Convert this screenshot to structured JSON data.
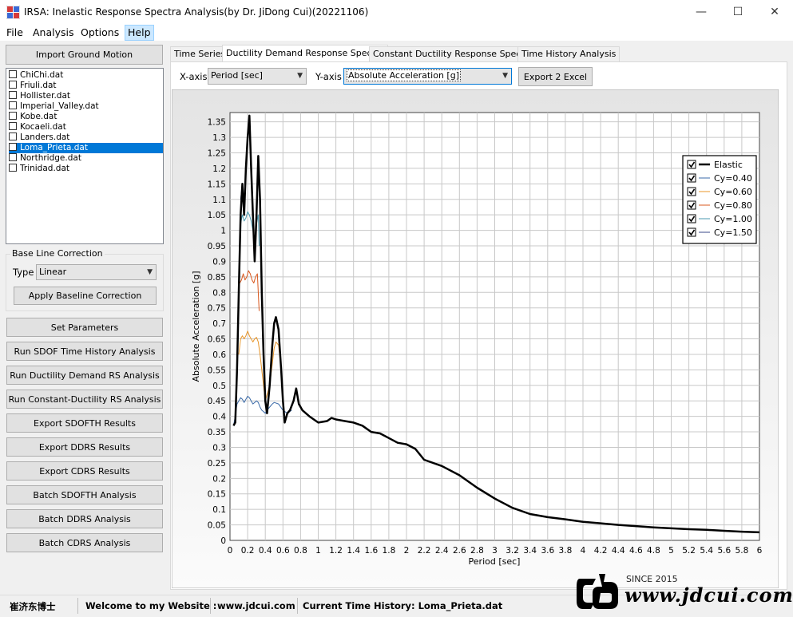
{
  "window": {
    "title": "IRSA: Inelastic Response Spectra Analysis(by Dr. JiDong Cui)(20221106)",
    "minimize": "—",
    "maximize": "☐",
    "close": "✕"
  },
  "menu": [
    "File",
    "Analysis",
    "Options",
    "Help"
  ],
  "left": {
    "import_button": "Import Ground Motion",
    "files": [
      "ChiChi.dat",
      "Friuli.dat",
      "Hollister.dat",
      "Imperial_Valley.dat",
      "Kobe.dat",
      "Kocaeli.dat",
      "Landers.dat",
      "Loma_Prieta.dat",
      "Northridge.dat",
      "Trinidad.dat"
    ],
    "selected_index": 7,
    "baseline": {
      "group_title": "Base Line Correction",
      "type_label": "Type",
      "type_value": "Linear",
      "apply_button": "Apply Baseline Correction"
    },
    "buttons": [
      "Set Parameters",
      "Run SDOF Time History Analysis",
      "Run Ductility Demand RS Analysis",
      "Run Constant-Ductility RS Analysis",
      "Export SDOFTH Results",
      "Export DDRS Results",
      "Export CDRS Results",
      "Batch SDOFTH Analysis",
      "Batch DDRS Analysis",
      "Batch CDRS Analysis"
    ]
  },
  "tabs": [
    "Time Series",
    "Ductility Demand Response Spectra",
    "Constant Ductility Response Spectra",
    "Time History Analysis"
  ],
  "active_tab": 1,
  "toolbar": {
    "xaxis_label": "X-axis",
    "xaxis_value": "Period [sec]",
    "yaxis_label": "Y-axis",
    "yaxis_value": "Absolute Acceleration [g]",
    "export_button": "Export 2 Excel"
  },
  "status": {
    "author": "崔济东博士",
    "welcome": "Welcome to my Website :",
    "website": "www.jdcui.com",
    "current": "Current Time History: Loma_Prieta.dat"
  },
  "brand": {
    "since": "SINCE 2015",
    "url": "www.jdcui.com"
  },
  "chart_data": {
    "type": "line",
    "xlabel": "Period [sec]",
    "ylabel": "Absolute Acceleration [g]",
    "xlim": [
      0,
      6
    ],
    "ylim": [
      0,
      1.38
    ],
    "xticks": [
      "0",
      "0.2",
      "0.4",
      "0.6",
      "0.8",
      "1",
      "1.2",
      "1.4",
      "1.6",
      "1.8",
      "2",
      "2.2",
      "2.4",
      "2.6",
      "2.8",
      "3",
      "3.2",
      "3.4",
      "3.6",
      "3.8",
      "4",
      "4.2",
      "4.4",
      "4.6",
      "4.8",
      "5",
      "5.2",
      "5.4",
      "5.6",
      "5.8",
      "6"
    ],
    "yticks": [
      "0",
      "0.05",
      "0.1",
      "0.15",
      "0.2",
      "0.25",
      "0.3",
      "0.35",
      "0.4",
      "0.45",
      "0.5",
      "0.55",
      "0.6",
      "0.65",
      "0.7",
      "0.75",
      "0.8",
      "0.85",
      "0.9",
      "0.95",
      "1",
      "1.05",
      "1.1",
      "1.15",
      "1.2",
      "1.25",
      "1.3",
      "1.35"
    ],
    "grid": true,
    "legend_position": "top-right",
    "series": [
      {
        "name": "Elastic",
        "color": "#000000",
        "width": 2.5,
        "points": [
          [
            0.04,
            0.37
          ],
          [
            0.06,
            0.38
          ],
          [
            0.08,
            0.55
          ],
          [
            0.1,
            0.8
          ],
          [
            0.12,
            1.05
          ],
          [
            0.14,
            1.15
          ],
          [
            0.16,
            1.05
          ],
          [
            0.18,
            1.2
          ],
          [
            0.2,
            1.3
          ],
          [
            0.22,
            1.37
          ],
          [
            0.24,
            1.2
          ],
          [
            0.26,
            1.05
          ],
          [
            0.28,
            0.9
          ],
          [
            0.3,
            1.05
          ],
          [
            0.32,
            1.24
          ],
          [
            0.34,
            1.1
          ],
          [
            0.36,
            0.8
          ],
          [
            0.38,
            0.6
          ],
          [
            0.4,
            0.45
          ],
          [
            0.42,
            0.41
          ],
          [
            0.45,
            0.5
          ],
          [
            0.48,
            0.63
          ],
          [
            0.5,
            0.7
          ],
          [
            0.52,
            0.72
          ],
          [
            0.55,
            0.68
          ],
          [
            0.58,
            0.55
          ],
          [
            0.6,
            0.45
          ],
          [
            0.62,
            0.38
          ],
          [
            0.65,
            0.41
          ],
          [
            0.68,
            0.42
          ],
          [
            0.72,
            0.45
          ],
          [
            0.75,
            0.49
          ],
          [
            0.78,
            0.44
          ],
          [
            0.82,
            0.42
          ],
          [
            0.9,
            0.4
          ],
          [
            1.0,
            0.38
          ],
          [
            1.1,
            0.385
          ],
          [
            1.15,
            0.395
          ],
          [
            1.2,
            0.39
          ],
          [
            1.3,
            0.385
          ],
          [
            1.4,
            0.38
          ],
          [
            1.5,
            0.37
          ],
          [
            1.6,
            0.35
          ],
          [
            1.7,
            0.345
          ],
          [
            1.8,
            0.33
          ],
          [
            1.9,
            0.315
          ],
          [
            2.0,
            0.31
          ],
          [
            2.1,
            0.295
          ],
          [
            2.2,
            0.26
          ],
          [
            2.4,
            0.24
          ],
          [
            2.6,
            0.21
          ],
          [
            2.8,
            0.17
          ],
          [
            3.0,
            0.135
          ],
          [
            3.2,
            0.105
          ],
          [
            3.4,
            0.085
          ],
          [
            3.6,
            0.075
          ],
          [
            3.8,
            0.068
          ],
          [
            4.0,
            0.06
          ],
          [
            4.2,
            0.055
          ],
          [
            4.4,
            0.05
          ],
          [
            4.6,
            0.046
          ],
          [
            4.8,
            0.042
          ],
          [
            5.0,
            0.039
          ],
          [
            5.2,
            0.036
          ],
          [
            5.4,
            0.034
          ],
          [
            5.6,
            0.031
          ],
          [
            5.8,
            0.028
          ],
          [
            6.0,
            0.026
          ]
        ]
      },
      {
        "name": "Cy=0.40",
        "color": "#3a6aa8",
        "width": 1,
        "points": [
          [
            0.04,
            0.37
          ],
          [
            0.06,
            0.4
          ],
          [
            0.08,
            0.44
          ],
          [
            0.1,
            0.45
          ],
          [
            0.12,
            0.46
          ],
          [
            0.14,
            0.455
          ],
          [
            0.16,
            0.445
          ],
          [
            0.18,
            0.455
          ],
          [
            0.2,
            0.465
          ],
          [
            0.22,
            0.46
          ],
          [
            0.24,
            0.45
          ],
          [
            0.26,
            0.44
          ],
          [
            0.28,
            0.445
          ],
          [
            0.3,
            0.45
          ],
          [
            0.32,
            0.445
          ],
          [
            0.34,
            0.43
          ],
          [
            0.36,
            0.42
          ],
          [
            0.38,
            0.415
          ],
          [
            0.4,
            0.41
          ],
          [
            0.42,
            0.42
          ],
          [
            0.45,
            0.43
          ],
          [
            0.48,
            0.44
          ],
          [
            0.5,
            0.445
          ],
          [
            0.55,
            0.44
          ],
          [
            0.6,
            0.42
          ],
          [
            0.65,
            0.41
          ],
          [
            0.7,
            0.42
          ]
        ]
      },
      {
        "name": "Cy=0.60",
        "color": "#e8962a",
        "width": 1,
        "points": [
          [
            0.1,
            0.6
          ],
          [
            0.12,
            0.65
          ],
          [
            0.14,
            0.66
          ],
          [
            0.16,
            0.65
          ],
          [
            0.18,
            0.66
          ],
          [
            0.2,
            0.675
          ],
          [
            0.22,
            0.66
          ],
          [
            0.24,
            0.65
          ],
          [
            0.26,
            0.64
          ],
          [
            0.28,
            0.65
          ],
          [
            0.3,
            0.655
          ],
          [
            0.32,
            0.64
          ],
          [
            0.34,
            0.6
          ],
          [
            0.36,
            0.55
          ],
          [
            0.38,
            0.5
          ],
          [
            0.4,
            0.45
          ],
          [
            0.45,
            0.5
          ],
          [
            0.5,
            0.62
          ],
          [
            0.52,
            0.64
          ],
          [
            0.55,
            0.63
          ],
          [
            0.58,
            0.55
          ]
        ]
      },
      {
        "name": "Cy=0.80",
        "color": "#d9581e",
        "width": 1,
        "points": [
          [
            0.11,
            0.83
          ],
          [
            0.13,
            0.84
          ],
          [
            0.15,
            0.86
          ],
          [
            0.17,
            0.84
          ],
          [
            0.19,
            0.85
          ],
          [
            0.21,
            0.87
          ],
          [
            0.23,
            0.86
          ],
          [
            0.25,
            0.84
          ],
          [
            0.27,
            0.83
          ],
          [
            0.29,
            0.85
          ],
          [
            0.31,
            0.86
          ],
          [
            0.32,
            0.8
          ],
          [
            0.33,
            0.74
          ]
        ]
      },
      {
        "name": "Cy=1.00",
        "color": "#4a9ab0",
        "width": 1,
        "points": [
          [
            0.12,
            1.02
          ],
          [
            0.14,
            1.05
          ],
          [
            0.16,
            1.03
          ],
          [
            0.18,
            1.04
          ],
          [
            0.2,
            1.06
          ],
          [
            0.22,
            1.05
          ],
          [
            0.24,
            1.03
          ],
          [
            0.26,
            1.0
          ],
          [
            0.28,
            0.95
          ],
          [
            0.3,
            1.02
          ],
          [
            0.32,
            1.05
          ],
          [
            0.33,
            0.95
          ]
        ]
      },
      {
        "name": "Cy=1.50",
        "color": "#3a4a8a",
        "width": 1,
        "points": [
          [
            0.12,
            1.1
          ],
          [
            0.14,
            1.15
          ],
          [
            0.16,
            1.05
          ],
          [
            0.18,
            1.2
          ],
          [
            0.2,
            1.3
          ],
          [
            0.22,
            1.37
          ],
          [
            0.24,
            1.2
          ],
          [
            0.26,
            1.05
          ],
          [
            0.28,
            0.9
          ],
          [
            0.3,
            1.05
          ],
          [
            0.32,
            1.24
          ]
        ]
      }
    ]
  }
}
